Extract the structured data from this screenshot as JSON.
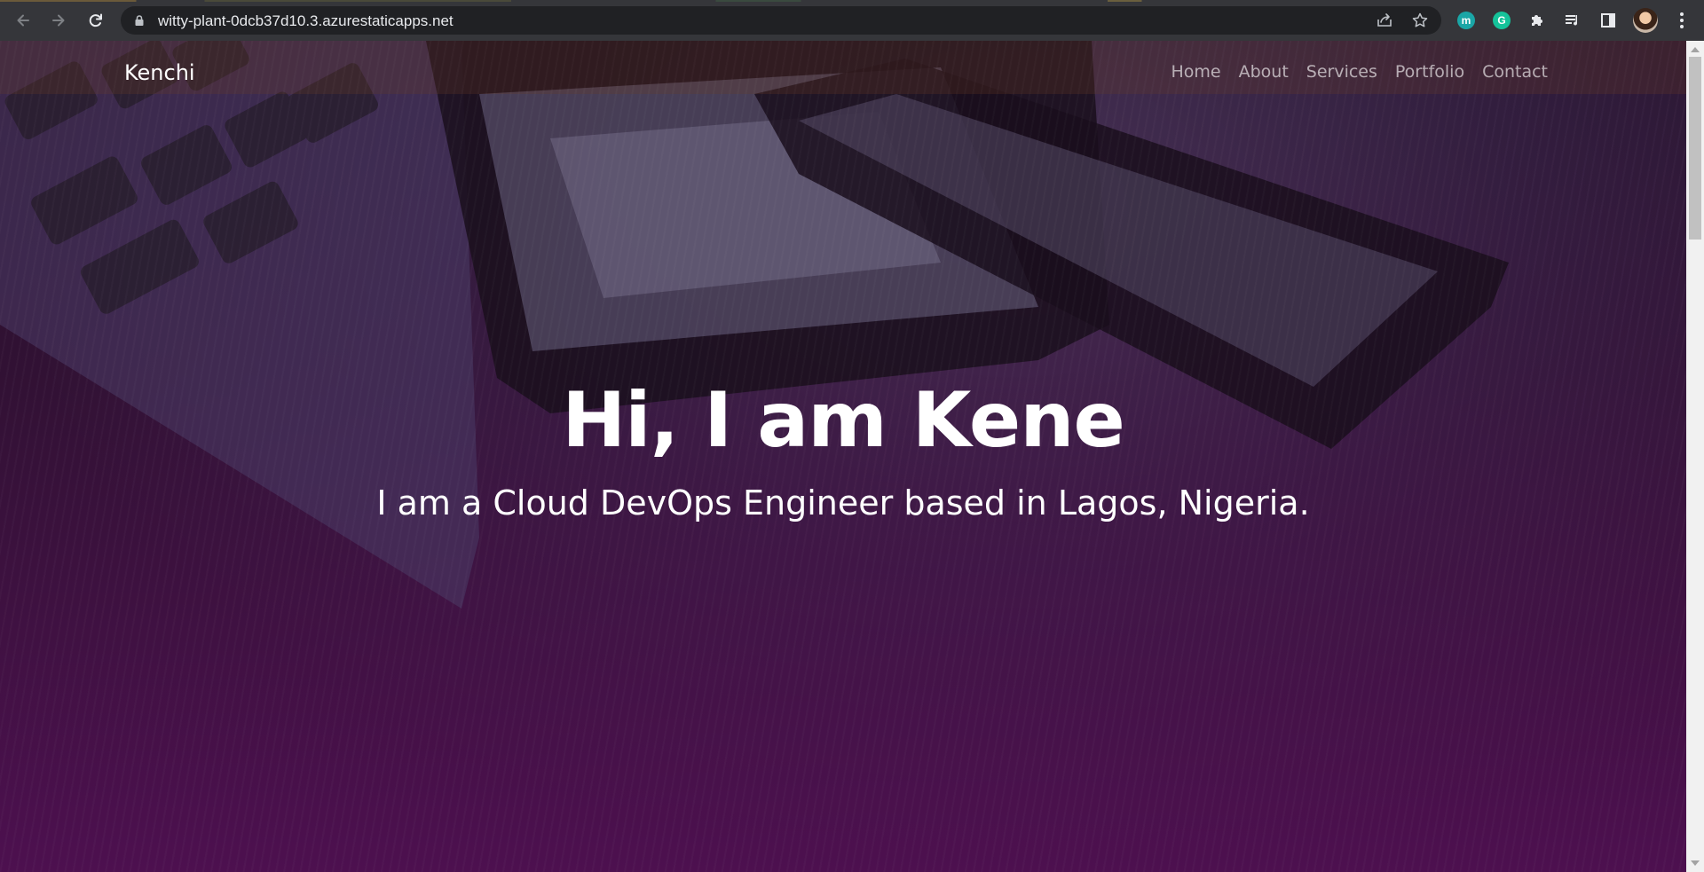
{
  "browser": {
    "url": "witty-plant-0dcb37d10.3.azurestaticapps.net",
    "icons": {
      "back": "arrow-left-icon",
      "forward": "arrow-right-icon",
      "reload": "reload-icon",
      "lock": "lock-icon",
      "share": "share-icon",
      "bookmark": "star-icon",
      "extensions": "puzzle-icon",
      "media": "media-queue-icon",
      "sidepanel": "side-panel-icon",
      "menu": "kebab-menu-icon"
    },
    "extensions": [
      {
        "letter": "m",
        "color": "#1aa6a6"
      },
      {
        "letter": "G",
        "color": "#15c39a"
      }
    ]
  },
  "site": {
    "brand": "Kenchi",
    "nav": [
      {
        "label": "Home"
      },
      {
        "label": "About"
      },
      {
        "label": "Services"
      },
      {
        "label": "Portfolio"
      },
      {
        "label": "Contact"
      }
    ],
    "hero": {
      "title": "Hi, I am Kene",
      "subtitle": "I am a Cloud DevOps Engineer based in Lagos, Nigeria."
    }
  },
  "colors": {
    "chrome": "#35363a",
    "omnibox": "#202124",
    "hero_bottom": "#501052",
    "text": "#ffffff"
  }
}
